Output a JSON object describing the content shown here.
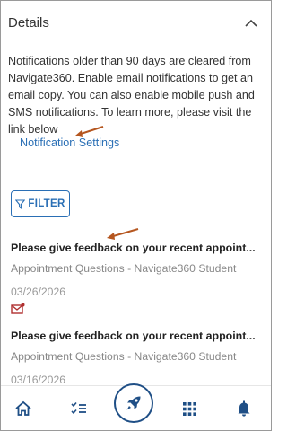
{
  "details": {
    "title": "Details",
    "info": "Notifications older than 90 days are cleared from Navigate360. Enable email notifications to get an email copy. You can also enable mobile push and SMS notifications. To learn more, please visit the link below",
    "settings_link": "Notification Settings"
  },
  "filter": {
    "label": "FILTER"
  },
  "notifications": [
    {
      "title": "Please give feedback on your recent appoint...",
      "source": "Appointment Questions - Navigate360 Student",
      "date": "03/26/2026"
    },
    {
      "title": "Please give feedback on your recent appoint...",
      "source": "Appointment Questions - Navigate360 Student",
      "date": "03/16/2026"
    }
  ],
  "nav": {
    "items": [
      {
        "icon": "home-icon"
      },
      {
        "icon": "checklist-icon"
      },
      {
        "icon": "rocket-icon"
      },
      {
        "icon": "grid-icon"
      },
      {
        "icon": "bell-icon"
      }
    ]
  },
  "colors": {
    "accent": "#2a6fb5",
    "nav_dark": "#1f4f86",
    "annotation_arrow": "#b5561f",
    "mail_icon": "#b03030"
  }
}
